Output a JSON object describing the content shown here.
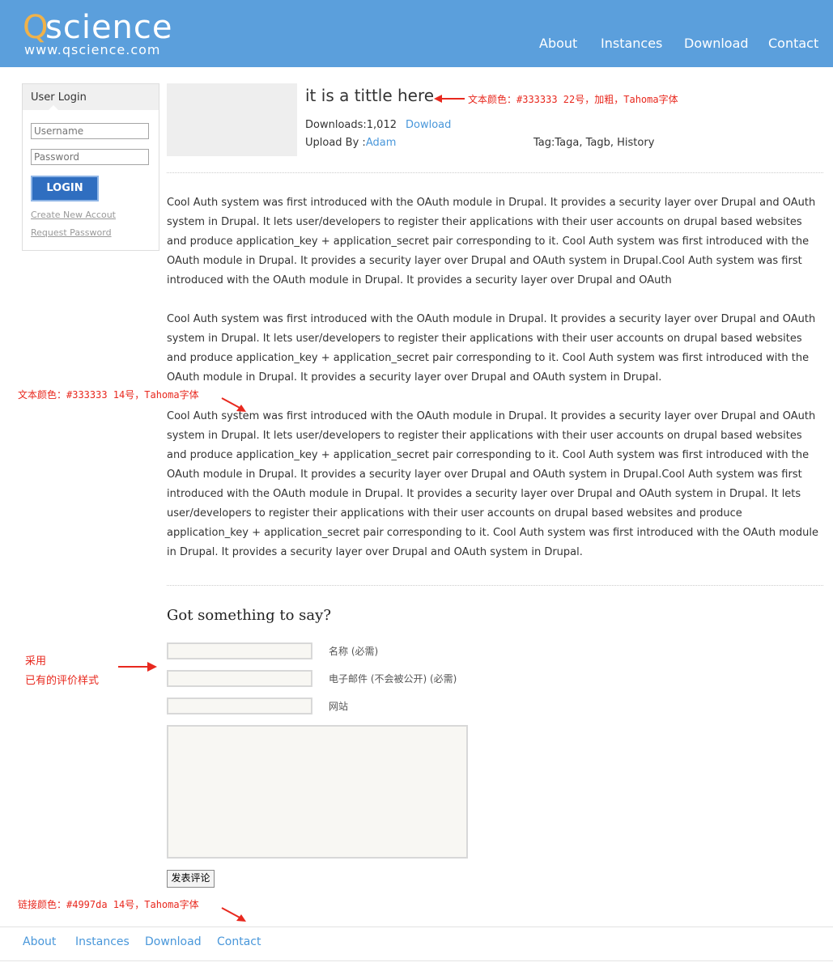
{
  "header": {
    "logo_q": "Q",
    "logo_rest": "science",
    "logo_sub": "www.qscience.com",
    "nav": [
      "About",
      "Instances",
      "Download",
      "Contact"
    ],
    "bg_color": "#5b9fdc"
  },
  "login": {
    "title": "User Login",
    "username_placeholder": "Username",
    "password_placeholder": "Password",
    "button": "LOGIN",
    "create_link": "Create New Accout",
    "request_link": "Request Password"
  },
  "item": {
    "title": "it is a tittle here",
    "downloads_label": "Downloads:1,012",
    "download_link": "Dowload",
    "upload_label": "Upload By :",
    "uploader": "Adam",
    "tags": "Tag:Taga, Tagb, History"
  },
  "annotations": {
    "title_note": "文本颜色：#333333  22号，加粗，Tahoma字体",
    "body_note": "文本颜色：#333333  14号，Tahoma字体",
    "comment_note_1": "采用",
    "comment_note_2": "已有的评价样式",
    "link_note": "链接颜色：#4997da  14号，Tahoma字体",
    "color": "#e8281e"
  },
  "body": {
    "paragraphs": [
      "Cool Auth system was first introduced with the OAuth module in Drupal. It provides a security layer over Drupal and OAuth system in Drupal. It lets user/developers to register their applications with their user accounts on drupal based websites and produce application_key + application_secret pair corresponding to it. Cool Auth system was first introduced with the OAuth module in Drupal. It provides a security layer over Drupal and OAuth system in Drupal.Cool Auth system was first introduced with the OAuth module in Drupal. It provides a security layer over Drupal and OAuth",
      "Cool Auth system was first introduced with the OAuth module in Drupal. It provides a security layer over Drupal and OAuth system in Drupal. It lets user/developers to register their applications with their user accounts on drupal based websites and produce application_key + application_secret pair corresponding to it. Cool Auth system was first introduced with the OAuth module in Drupal. It provides a security layer over Drupal and OAuth system in Drupal.",
      "Cool Auth system was first introduced with the OAuth module in Drupal. It provides a security layer over Drupal and OAuth system in Drupal. It lets user/developers to register their applications with their user accounts on drupal based websites and produce application_key + application_secret pair corresponding to it. Cool Auth system was first introduced with the OAuth module in Drupal. It provides a security layer over Drupal and OAuth system in Drupal.Cool Auth system was first introduced with the OAuth module in Drupal. It provides a security layer over Drupal and OAuth system in Drupal. It lets user/developers to register their applications with their user accounts on drupal based websites and produce application_key + application_secret pair corresponding to it. Cool Auth system was first introduced with the OAuth module in Drupal. It provides a security layer over Drupal and OAuth system in Drupal."
    ]
  },
  "comment": {
    "title": "Got something to say?",
    "name_label": "名称 (必需)",
    "email_label": "电子邮件 (不会被公开) (必需)",
    "website_label": "网站",
    "submit": "发表评论"
  },
  "footer": {
    "links": [
      "About",
      "Instances",
      "Download",
      "Contact"
    ],
    "link_color": "#4997da"
  }
}
